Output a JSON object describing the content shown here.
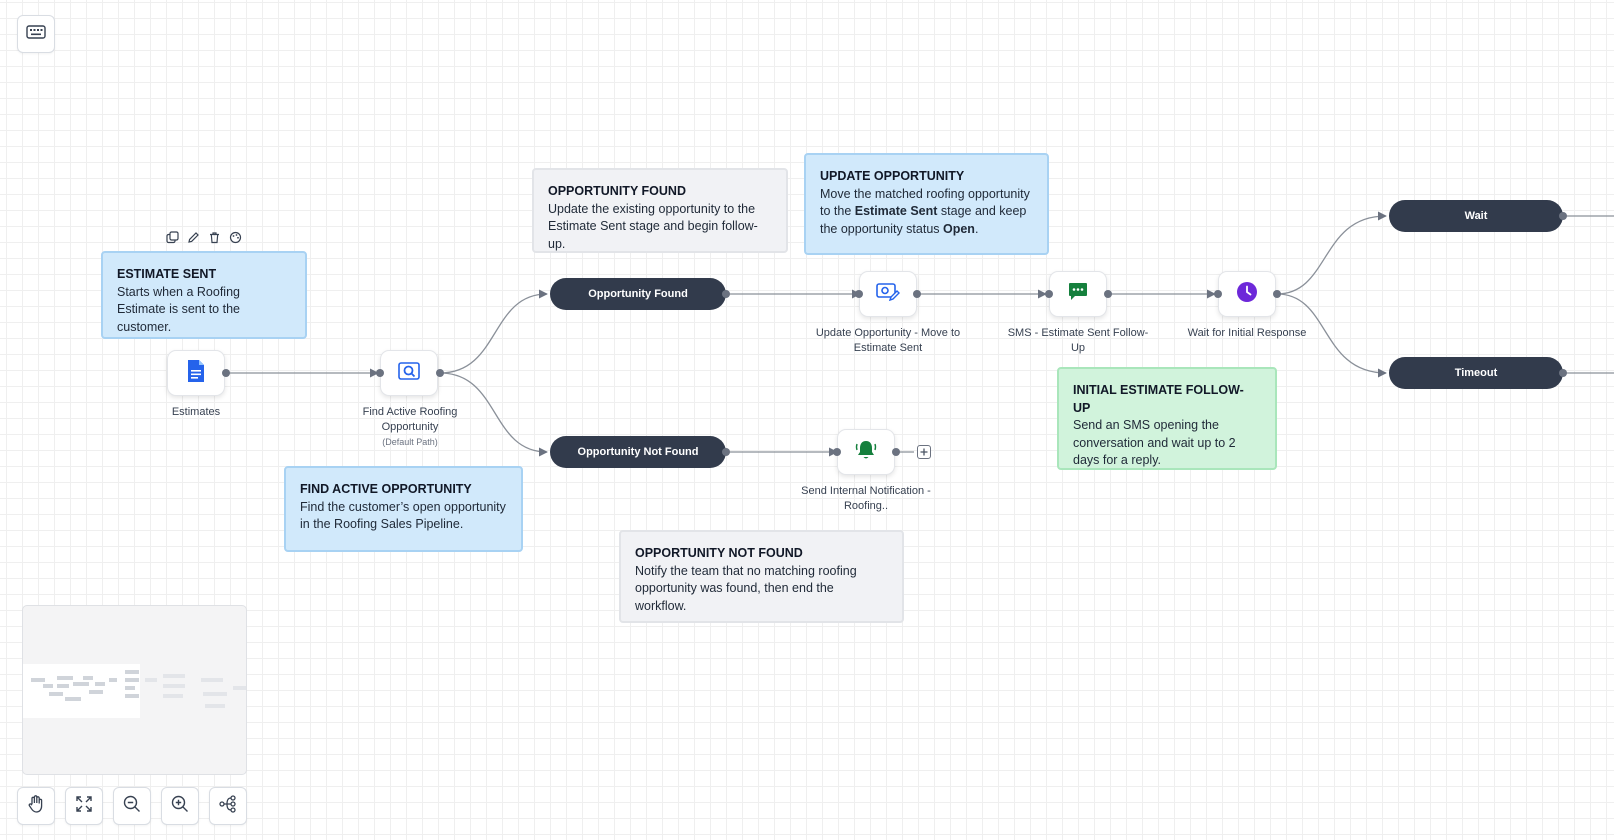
{
  "toolbar": {
    "keyboard_icon": "keyboard-icon"
  },
  "notes": {
    "estimate_sent": {
      "title": "ESTIMATE SENT",
      "body": "Starts when a Roofing Estimate is sent to the customer."
    },
    "find_active": {
      "title": "FIND ACTIVE OPPORTUNITY",
      "body": "Find the customer’s open opportunity in the Roofing Sales Pipeline."
    },
    "opp_found": {
      "title": "OPPORTUNITY FOUND",
      "body": "Update the existing opportunity to the Estimate Sent stage and begin follow-up."
    },
    "update_opp": {
      "title": "UPDATE OPPORTUNITY",
      "body_1": "Move the matched roofing opportunity to the ",
      "body_bold_1": "Estimate Sent",
      "body_2": " stage and keep the opportunity status ",
      "body_bold_2": "Open",
      "body_3": "."
    },
    "opp_not_found": {
      "title": "OPPORTUNITY NOT FOUND",
      "body": "Notify the team that no matching roofing opportunity was found, then end the workflow."
    },
    "initial_followup": {
      "title": "INITIAL ESTIMATE FOLLOW-UP",
      "body": "Send an SMS opening the conversation and wait up to 2 days for a reply."
    }
  },
  "nodes": {
    "estimates": {
      "label": "Estimates",
      "icon": "document-icon",
      "color": "#2563eb"
    },
    "find_active": {
      "label": "Find Active Roofing Opportunity",
      "sub": "(Default Path)",
      "icon": "search-icon",
      "color": "#2563eb"
    },
    "update_opp": {
      "label": "Update Opportunity - Move to Estimate Sent",
      "icon": "update-opportunity-icon",
      "color": "#2563eb"
    },
    "sms": {
      "label": "SMS - Estimate Sent Follow-Up",
      "icon": "chat-icon",
      "color": "#15803d"
    },
    "wait": {
      "label": "Wait for Initial Response",
      "icon": "clock-icon",
      "color": "#6d28d9"
    },
    "notify": {
      "label": "Send Internal Notification - Roofing..",
      "icon": "bell-icon",
      "color": "#15803d"
    }
  },
  "branches": {
    "opp_found": "Opportunity Found",
    "opp_not_found": "Opportunity Not Found",
    "wait": "Wait",
    "timeout": "Timeout"
  },
  "controls": [
    "hand-icon",
    "fit-view-icon",
    "zoom-out-icon",
    "zoom-in-icon",
    "layout-icon"
  ]
}
